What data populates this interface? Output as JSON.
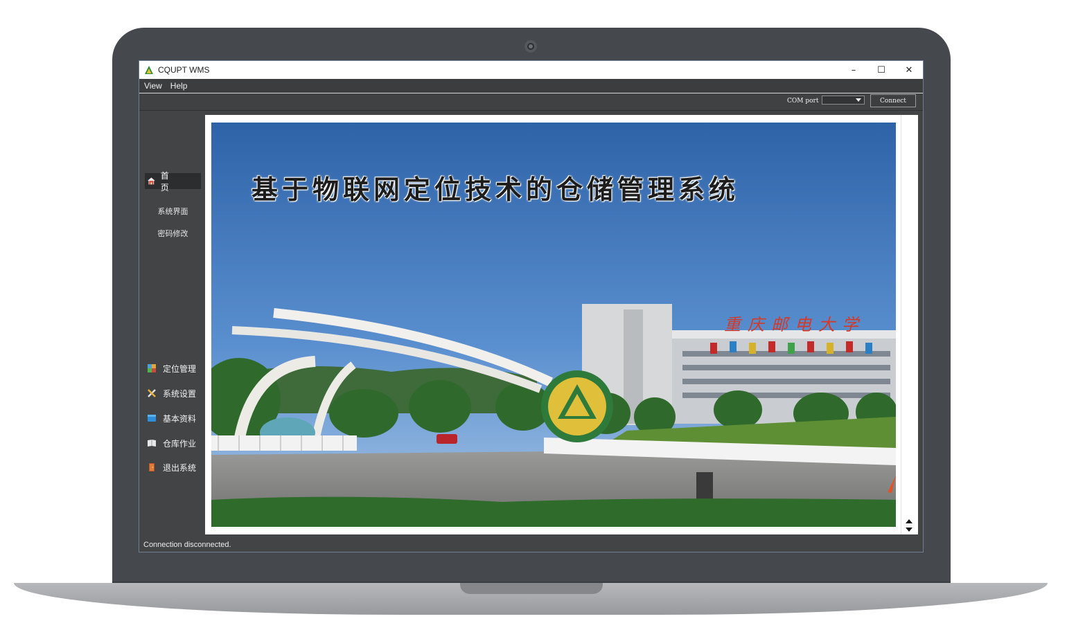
{
  "window": {
    "title": "CQUPT WMS",
    "controls": {
      "minimize": "–",
      "maximize": "☐",
      "close": "✕"
    }
  },
  "menu": {
    "items": [
      "View",
      "Help"
    ]
  },
  "toolbar": {
    "com_port_label": "COM port",
    "com_port_value": "",
    "connect_label": "Connect"
  },
  "sidebar": {
    "home_label": "首 页",
    "sub_items": [
      "系统界面",
      "密码修改"
    ],
    "nav_items": [
      {
        "label": "定位管理",
        "icon": "map-icon"
      },
      {
        "label": "系统设置",
        "icon": "tools-icon"
      },
      {
        "label": "基本资料",
        "icon": "folder-icon"
      },
      {
        "label": "仓库作业",
        "icon": "book-icon"
      },
      {
        "label": "退出系统",
        "icon": "exit-icon"
      }
    ]
  },
  "banner": {
    "title": "基于物联网定位技术的仓储管理系统",
    "sign_text": "重庆邮电大学"
  },
  "status": {
    "message": "Connection disconnected."
  },
  "colors": {
    "window_bg": "#434446",
    "accent_border": "#6e7f94",
    "sky": "#3f74b7"
  }
}
